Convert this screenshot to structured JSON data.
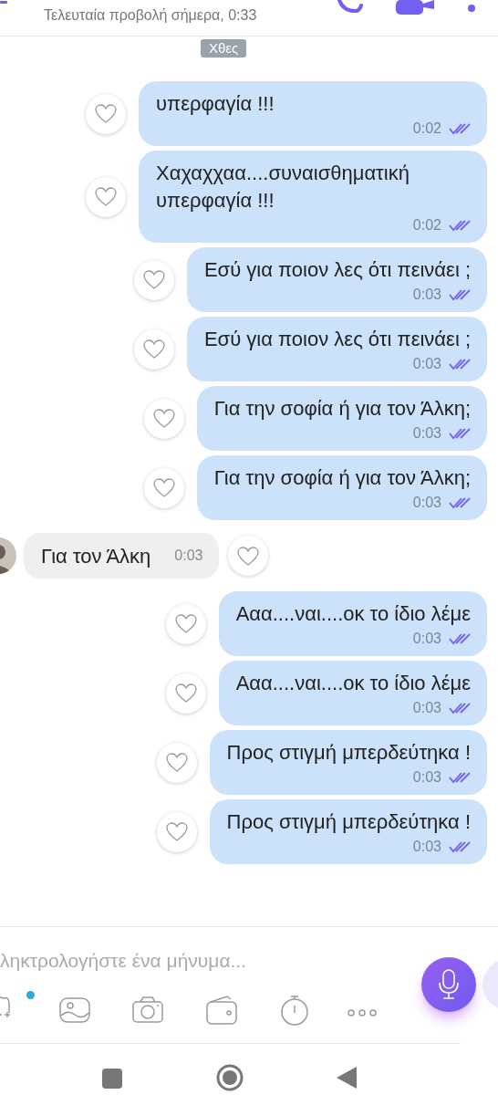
{
  "header": {
    "subtitle": "Τελευταία προβολή σήμερα, 0:33"
  },
  "date_label": "Χθες",
  "messages": [
    {
      "kind": "outgoing",
      "text": "υπερφαγία !!!",
      "time": "0:02",
      "read": true
    },
    {
      "kind": "outgoing",
      "text": "Χαχαχχαα....συναισθηματική υπερφαγία !!!",
      "time": "0:02",
      "read": true
    },
    {
      "kind": "outgoing",
      "text": "Εσύ για ποιον λες ότι πεινάει ;",
      "time": "0:03",
      "read": true
    },
    {
      "kind": "outgoing",
      "text": "Εσύ για ποιον λες ότι πεινάει ;",
      "time": "0:03",
      "read": true
    },
    {
      "kind": "outgoing",
      "text": "Για την σοφία ή για τον Άλκη;",
      "time": "0:03",
      "read": true
    },
    {
      "kind": "outgoing",
      "text": "Για την σοφία ή για τον Άλκη;",
      "time": "0:03",
      "read": true
    },
    {
      "kind": "incoming",
      "text": "Για τον Άλκη",
      "time": "0:03"
    },
    {
      "kind": "outgoing",
      "text": "Ααα....ναι....οκ το ίδιο λέμε",
      "time": "0:03",
      "read": true
    },
    {
      "kind": "outgoing",
      "text": "Ααα....ναι....οκ το ίδιο λέμε",
      "time": "0:03",
      "read": true
    },
    {
      "kind": "outgoing",
      "text": "Προς στιγμή μπερδεύτηκα !",
      "time": "0:03",
      "read": true
    },
    {
      "kind": "outgoing",
      "text": "Προς στιγμή μπερδεύτηκα !",
      "time": "0:03",
      "read": true
    }
  ],
  "composer": {
    "placeholder": "ληκτρολογήστε ένα μήνυμα...",
    "sticker_badge": true
  }
}
